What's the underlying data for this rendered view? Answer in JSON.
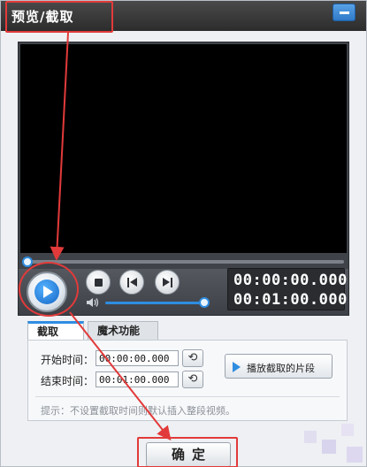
{
  "window": {
    "title": "预览/截取"
  },
  "player": {
    "current_time": "00:00:00.000",
    "total_time": "00:01:00.000",
    "progress_fraction": 0.0,
    "volume_fraction": 1.0
  },
  "tabs": [
    {
      "label": "截取"
    },
    {
      "label": "魔术功能"
    }
  ],
  "trim": {
    "start_label": "开始时间：",
    "start_value": "00:00:00.000",
    "end_label": "结束时间：",
    "end_value": "00:01:00.000",
    "play_clip_label": "播放截取的片段",
    "hint": "提示：不设置截取时间则默认插入整段视频。"
  },
  "footer": {
    "ok_label": "确定"
  },
  "colors": {
    "accent": "#2f8de0",
    "annotation": "#e23a3a",
    "titlebar": "#2c2c2c"
  },
  "icons": {
    "minimize": "minimize-icon",
    "play": "play-icon",
    "stop": "stop-icon",
    "previous": "previous-icon",
    "next": "next-icon",
    "volume": "volume-icon",
    "reset": "reset-icon"
  }
}
